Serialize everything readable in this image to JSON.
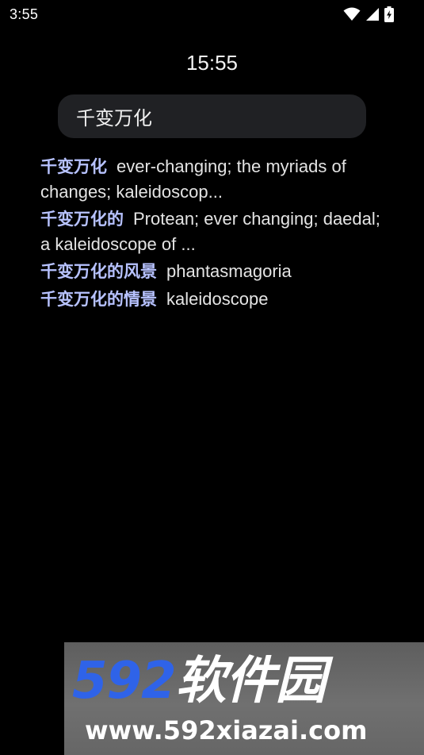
{
  "status_bar": {
    "time": "3:55",
    "icons": [
      "wifi-icon",
      "signal-icon",
      "battery-charging-icon"
    ]
  },
  "clock": "15:55",
  "search": {
    "query": "千变万化"
  },
  "results": [
    {
      "term": "千变万化",
      "definition": "ever-changing; the myriads of changes; kaleidoscop..."
    },
    {
      "term": "千变万化的",
      "definition": "Protean; ever changing; daedal; a kaleidoscope of ..."
    },
    {
      "term": "千变万化的风景",
      "definition": "phantasmagoria"
    },
    {
      "term": "千变万化的情景",
      "definition": "kaleidoscope"
    }
  ],
  "watermark": {
    "logo_number": "592",
    "logo_text": "软件园",
    "url": "www.592xiazai.com"
  },
  "colors": {
    "background": "#000000",
    "search_background": "#202124",
    "term_color": "#b7c2ff",
    "watermark_blue": "#2f63e8"
  }
}
